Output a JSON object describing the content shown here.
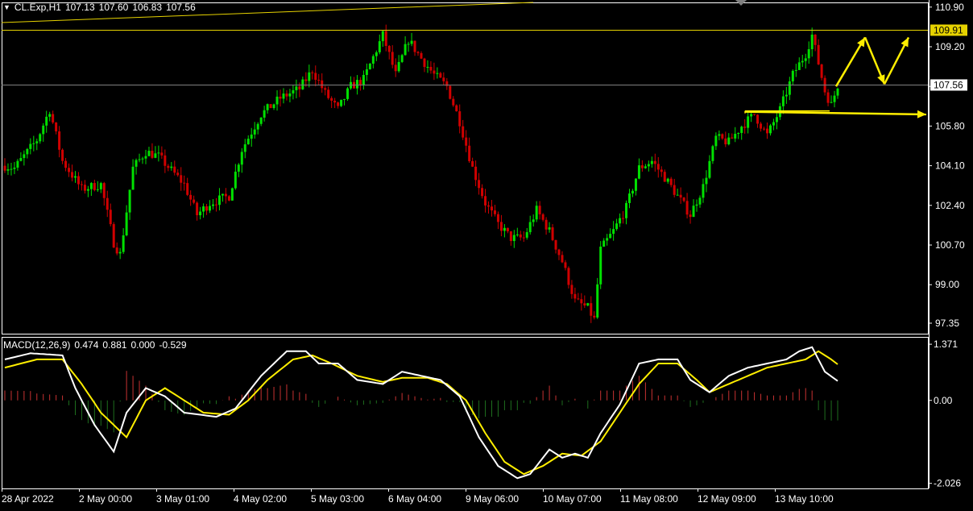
{
  "header": {
    "symbol": "CL.Exp,H1",
    "open": "107.13",
    "high": "107.60",
    "low": "106.83",
    "close": "107.56"
  },
  "price_axis": {
    "ticks": [
      "110.90",
      "109.20",
      "107.50",
      "105.80",
      "104.10",
      "102.40",
      "100.70",
      "99.00",
      "97.35"
    ],
    "tick_values": [
      110.9,
      109.2,
      107.5,
      105.8,
      104.1,
      102.4,
      100.7,
      99.0,
      97.35
    ],
    "current_price_label": "107.56",
    "level_label": "109.91"
  },
  "macd": {
    "label": "MACD(12,26,9)",
    "values": [
      "0.474",
      "0.881",
      "0.000",
      "-0.529"
    ],
    "axis_ticks": [
      "1.371",
      "0.00",
      "-2.026"
    ],
    "axis_values": [
      1.371,
      0.0,
      -2.026
    ]
  },
  "time_axis": {
    "labels": [
      "28 Apr 2022",
      "2 May 00:00",
      "3 May 01:00",
      "4 May 02:00",
      "5 May 03:00",
      "6 May 04:00",
      "9 May 06:00",
      "10 May 07:00",
      "11 May 08:00",
      "12 May 09:00",
      "13 May 10:00"
    ]
  },
  "colors": {
    "background": "#000000",
    "bull": "#00e000",
    "bear": "#d00000",
    "macd_main": "#ffffff",
    "macd_signal": "#ffee00",
    "hist_pos": "#c83232",
    "hist_neg": "#1e6e1e",
    "level_line": "#e6d200",
    "arrow": "#ffee00",
    "grid_line": "#808080"
  },
  "chart_data": {
    "type": "candlestick",
    "symbol": "CL.Exp",
    "timeframe": "H1",
    "ylim": [
      96.9,
      111.1
    ],
    "horizontal_levels": [
      109.91,
      107.56
    ],
    "close_path_keypoints": [
      [
        0,
        104.1
      ],
      [
        3,
        104.0
      ],
      [
        10,
        105.2
      ],
      [
        14,
        106.5
      ],
      [
        18,
        104.3
      ],
      [
        24,
        103.1
      ],
      [
        30,
        103.3
      ],
      [
        34,
        100.8
      ],
      [
        36,
        100.3
      ],
      [
        40,
        104.0
      ],
      [
        44,
        104.7
      ],
      [
        48,
        104.5
      ],
      [
        52,
        103.9
      ],
      [
        56,
        103.3
      ],
      [
        60,
        102.0
      ],
      [
        64,
        102.5
      ],
      [
        70,
        102.8
      ],
      [
        74,
        104.8
      ],
      [
        80,
        106.3
      ],
      [
        86,
        107.0
      ],
      [
        92,
        107.4
      ],
      [
        96,
        108.2
      ],
      [
        100,
        107.2
      ],
      [
        104,
        106.5
      ],
      [
        108,
        107.5
      ],
      [
        112,
        107.8
      ],
      [
        118,
        109.7
      ],
      [
        122,
        108.0
      ],
      [
        126,
        109.5
      ],
      [
        130,
        108.7
      ],
      [
        134,
        108.0
      ],
      [
        138,
        107.5
      ],
      [
        142,
        106.0
      ],
      [
        146,
        104.0
      ],
      [
        150,
        102.5
      ],
      [
        154,
        101.6
      ],
      [
        158,
        101.0
      ],
      [
        162,
        101.0
      ],
      [
        166,
        102.2
      ],
      [
        170,
        101.3
      ],
      [
        174,
        100.0
      ],
      [
        178,
        98.3
      ],
      [
        182,
        98.0
      ],
      [
        184,
        97.5
      ],
      [
        186,
        100.5
      ],
      [
        190,
        101.3
      ],
      [
        194,
        102.3
      ],
      [
        198,
        104.0
      ],
      [
        202,
        104.3
      ],
      [
        206,
        103.6
      ],
      [
        210,
        102.8
      ],
      [
        214,
        102.0
      ],
      [
        218,
        103.2
      ],
      [
        222,
        105.3
      ],
      [
        226,
        105.1
      ],
      [
        230,
        105.8
      ],
      [
        234,
        106.3
      ],
      [
        238,
        105.4
      ],
      [
        242,
        106.5
      ],
      [
        246,
        108.0
      ],
      [
        250,
        108.9
      ],
      [
        252,
        109.7
      ],
      [
        254,
        108.5
      ],
      [
        256,
        107.3
      ],
      [
        258,
        106.7
      ],
      [
        260,
        107.56
      ]
    ],
    "macd_main_keypoints": [
      [
        0,
        1.0
      ],
      [
        8,
        1.15
      ],
      [
        18,
        1.1
      ],
      [
        22,
        0.3
      ],
      [
        28,
        -0.6
      ],
      [
        34,
        -1.25
      ],
      [
        38,
        -0.3
      ],
      [
        44,
        0.3
      ],
      [
        50,
        0.1
      ],
      [
        56,
        -0.3
      ],
      [
        66,
        -0.4
      ],
      [
        72,
        -0.2
      ],
      [
        80,
        0.6
      ],
      [
        88,
        1.2
      ],
      [
        94,
        1.2
      ],
      [
        98,
        0.9
      ],
      [
        104,
        0.9
      ],
      [
        110,
        0.5
      ],
      [
        118,
        0.4
      ],
      [
        124,
        0.7
      ],
      [
        130,
        0.6
      ],
      [
        136,
        0.5
      ],
      [
        142,
        0.1
      ],
      [
        148,
        -0.9
      ],
      [
        154,
        -1.6
      ],
      [
        160,
        -1.9
      ],
      [
        164,
        -1.8
      ],
      [
        170,
        -1.2
      ],
      [
        174,
        -1.4
      ],
      [
        178,
        -1.3
      ],
      [
        182,
        -1.4
      ],
      [
        186,
        -0.8
      ],
      [
        192,
        -0.1
      ],
      [
        198,
        0.9
      ],
      [
        204,
        1.0
      ],
      [
        210,
        1.0
      ],
      [
        214,
        0.5
      ],
      [
        220,
        0.2
      ],
      [
        226,
        0.6
      ],
      [
        232,
        0.8
      ],
      [
        238,
        0.9
      ],
      [
        244,
        1.0
      ],
      [
        248,
        1.2
      ],
      [
        252,
        1.3
      ],
      [
        256,
        0.7
      ],
      [
        260,
        0.474
      ]
    ],
    "macd_signal_keypoints": [
      [
        0,
        0.8
      ],
      [
        10,
        1.0
      ],
      [
        18,
        1.0
      ],
      [
        24,
        0.4
      ],
      [
        30,
        -0.3
      ],
      [
        38,
        -0.9
      ],
      [
        44,
        0.0
      ],
      [
        50,
        0.3
      ],
      [
        56,
        0.0
      ],
      [
        62,
        -0.3
      ],
      [
        70,
        -0.35
      ],
      [
        76,
        0.0
      ],
      [
        82,
        0.5
      ],
      [
        90,
        1.0
      ],
      [
        96,
        1.1
      ],
      [
        102,
        0.9
      ],
      [
        110,
        0.6
      ],
      [
        118,
        0.45
      ],
      [
        124,
        0.55
      ],
      [
        132,
        0.55
      ],
      [
        138,
        0.4
      ],
      [
        144,
        0.0
      ],
      [
        150,
        -0.8
      ],
      [
        156,
        -1.5
      ],
      [
        162,
        -1.8
      ],
      [
        168,
        -1.6
      ],
      [
        174,
        -1.3
      ],
      [
        180,
        -1.35
      ],
      [
        186,
        -1.0
      ],
      [
        192,
        -0.3
      ],
      [
        198,
        0.4
      ],
      [
        204,
        0.9
      ],
      [
        210,
        0.9
      ],
      [
        216,
        0.5
      ],
      [
        220,
        0.2
      ],
      [
        226,
        0.4
      ],
      [
        232,
        0.6
      ],
      [
        238,
        0.8
      ],
      [
        244,
        0.9
      ],
      [
        250,
        1.0
      ],
      [
        254,
        1.2
      ],
      [
        258,
        1.0
      ],
      [
        260,
        0.881
      ]
    ],
    "forecast_arrows": [
      {
        "from": [
          107.5,
          "13 May 10:00 + 2h"
        ],
        "to": [
          109.6,
          "13 May 10:00 + 10h"
        ]
      },
      {
        "from": [
          109.6,
          "13 May 10:00 + 10h"
        ],
        "to": [
          107.6,
          "13 May 10:00 + 17h"
        ]
      },
      {
        "from": [
          107.6,
          "13 May 10:00 + 17h"
        ],
        "to": [
          109.6,
          "13 May 10:00 + 26h"
        ]
      },
      {
        "from": [
          106.45,
          "12 May 09:00 + ~6h"
        ],
        "to": [
          106.3,
          "13 May 10:00 + ~36h"
        ],
        "note": "horizontal support arrow"
      }
    ]
  }
}
